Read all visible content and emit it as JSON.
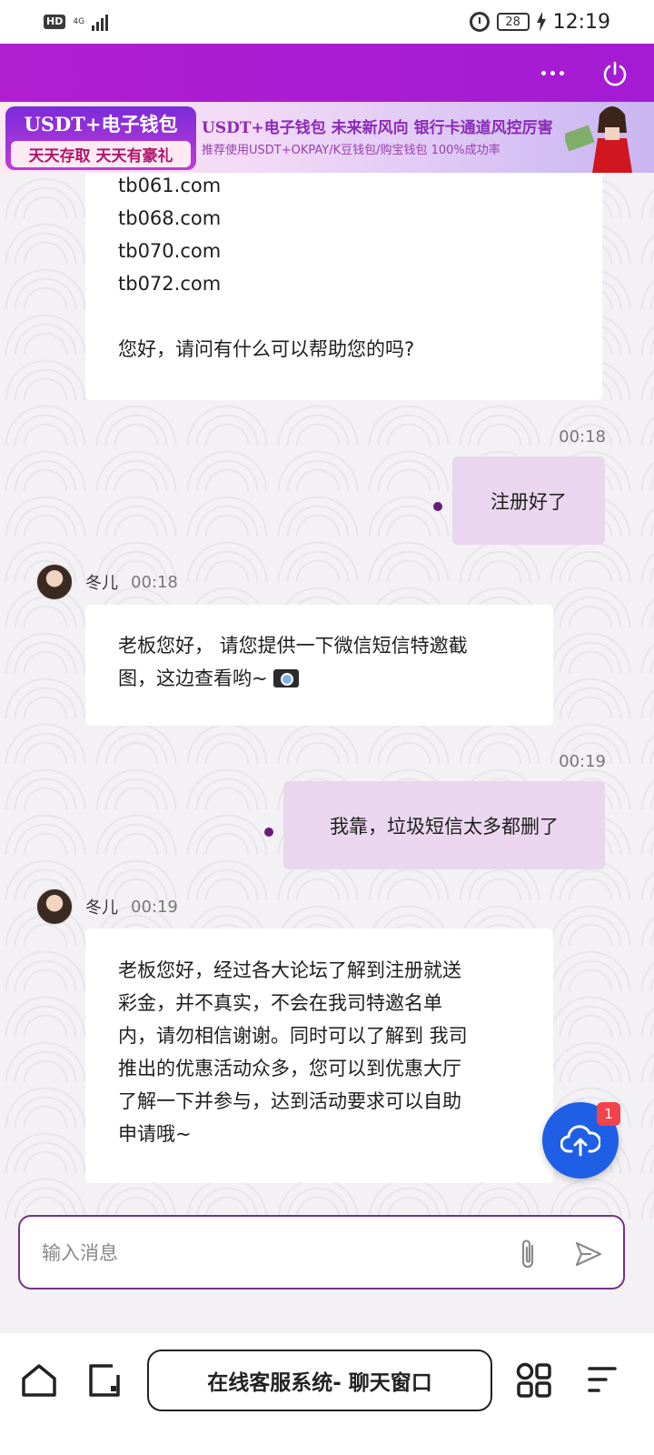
{
  "status_bar": {
    "hd": "HD",
    "network": "4G",
    "battery": "28",
    "time": "12:19"
  },
  "banner": {
    "badge_title": "USDT+电子钱包",
    "badge_sub": "天天存取 天天有豪礼",
    "title": "USDT+电子钱包   未来新风向   银行卡通道风控厉害",
    "subtitle": "推荐使用USDT+OKPAY/K豆钱包/购宝钱包    100%成功率"
  },
  "chat": {
    "first_message": {
      "lines": [
        "tb061.com",
        "tb068.com",
        "tb070.com",
        "tb072.com"
      ],
      "greeting": "您好，请问有什么可以帮助您的吗?"
    },
    "messages": [
      {
        "time": "00:18",
        "text": "注册好了"
      },
      {
        "sender": "冬儿",
        "time": "00:18",
        "text_line1": "老板您好， 请您提供一下微信短信特邀截",
        "text_line2": "图，这边查看哟~"
      },
      {
        "time": "00:19",
        "text": "我靠，垃圾短信太多都删了"
      },
      {
        "sender": "冬儿",
        "time": "00:19",
        "lines": [
          "老板您好，经过各大论坛了解到注册就送",
          "彩金，并不真实，不会在我司特邀名单",
          "内，请勿相信谢谢。同时可以了解到 我司",
          "推出的优惠活动众多，您可以到优惠大厅",
          "了解一下并参与，达到活动要求可以自助",
          "申请哦~"
        ]
      }
    ]
  },
  "upload": {
    "badge": "1"
  },
  "input": {
    "placeholder": "输入消息"
  },
  "bottom_nav": {
    "title": "在线客服系统- 聊天窗口"
  },
  "colors": {
    "header": "#b01ed0",
    "bubble_self": "#ead6ee",
    "fab": "#1f5fe6",
    "badge": "#f2444a"
  }
}
